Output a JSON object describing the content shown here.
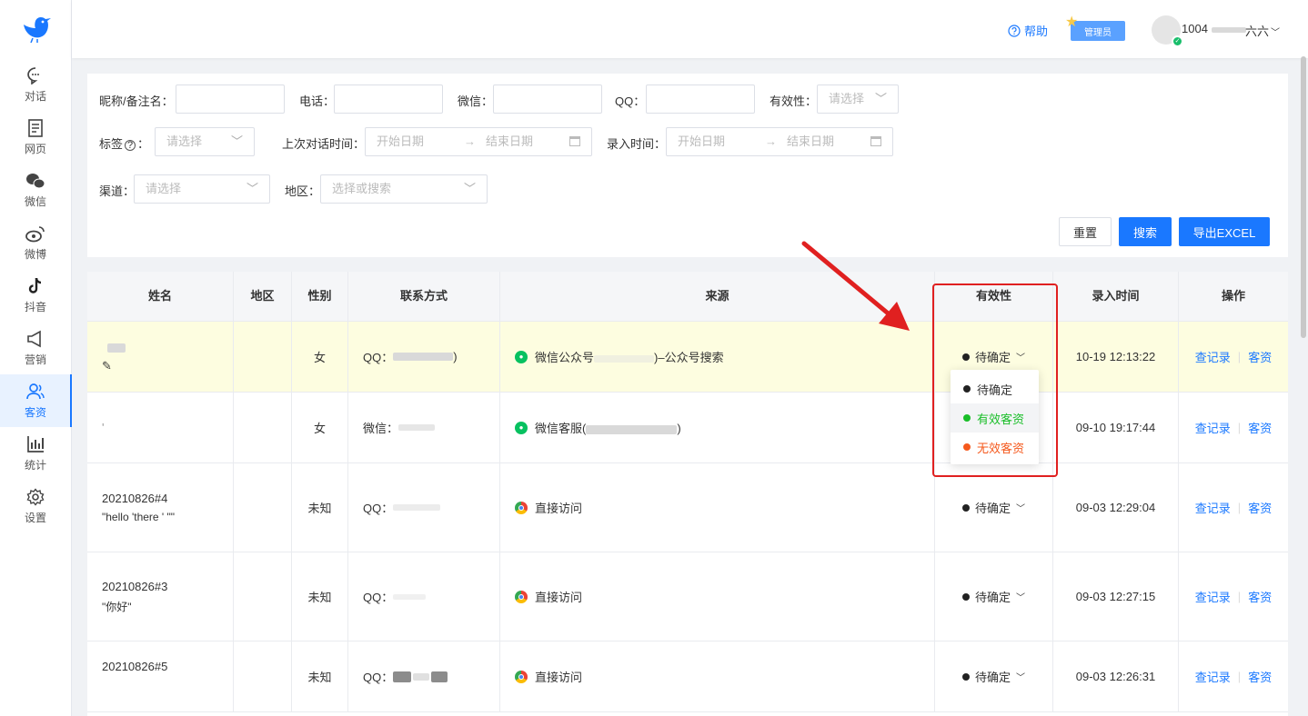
{
  "sidebar": {
    "items": [
      {
        "label": "对话",
        "icon": "chat-icon"
      },
      {
        "label": "网页",
        "icon": "webpage-icon"
      },
      {
        "label": "微信",
        "icon": "wechat-icon"
      },
      {
        "label": "微博",
        "icon": "weibo-icon"
      },
      {
        "label": "抖音",
        "icon": "douyin-icon"
      },
      {
        "label": "营销",
        "icon": "megaphone-icon"
      },
      {
        "label": "客资",
        "icon": "customers-icon"
      },
      {
        "label": "统计",
        "icon": "statistics-icon"
      },
      {
        "label": "设置",
        "icon": "gear-icon"
      }
    ],
    "active": "客资"
  },
  "header": {
    "help": "帮助",
    "admin_badge": "管理员",
    "user_id": "1004",
    "user_name": "六六"
  },
  "filters": {
    "nickname_label": "昵称/备注名：",
    "phone_label": "电话：",
    "wechat_label": "微信：",
    "qq_label": "QQ：",
    "validity_label": "有效性：",
    "validity_placeholder": "请选择",
    "tag_label": "标签",
    "tag_label_suffix": "：",
    "tag_placeholder": "请选择",
    "last_chat_label": "上次对话时间：",
    "entry_time_label": "录入时间：",
    "start_date": "开始日期",
    "end_date": "结束日期",
    "channel_label": "渠道：",
    "channel_placeholder": "请选择",
    "region_label": "地区：",
    "region_placeholder": "选择或搜索",
    "reset": "重置",
    "search": "搜索",
    "export": "导出EXCEL"
  },
  "table": {
    "columns": [
      "姓名",
      "地区",
      "性别",
      "联系方式",
      "来源",
      "有效性",
      "录入时间",
      "操作"
    ],
    "rows": [
      {
        "name": "",
        "name2": "",
        "gender": "女",
        "contact_prefix": "QQ：",
        "contact_suffix": ")",
        "source": "微信公众号",
        "source_suffix": ")–公众号搜索",
        "source_type": "wechat",
        "status": "待确定",
        "time": "10-19 12:13:22"
      },
      {
        "name": "'",
        "name2": "",
        "gender": "女",
        "contact_prefix": "微信：",
        "contact_suffix": "",
        "source": "微信客服(",
        "source_suffix": ")",
        "source_type": "wechat",
        "status": "",
        "time": "09-10 19:17:44"
      },
      {
        "name": "20210826#4",
        "name2": "\"hello 'there ' \"\"",
        "gender": "未知",
        "contact_prefix": "QQ：",
        "contact_suffix": "",
        "source": "直接访问",
        "source_suffix": "",
        "source_type": "chrome",
        "status": "待确定",
        "time": "09-03 12:29:04"
      },
      {
        "name": "20210826#3",
        "name2": "\"你好\"",
        "gender": "未知",
        "contact_prefix": "QQ：",
        "contact_suffix": "",
        "source": "直接访问",
        "source_suffix": "",
        "source_type": "chrome",
        "status": "待确定",
        "time": "09-03 12:27:15"
      },
      {
        "name": "20210826#5",
        "name2": "",
        "gender": "未知",
        "contact_prefix": "QQ：",
        "contact_suffix": "",
        "source": "直接访问",
        "source_suffix": "",
        "source_type": "chrome",
        "status": "待确定",
        "time": "09-03 12:26:31"
      }
    ],
    "actions": {
      "records": "查记录",
      "customer": "客资"
    }
  },
  "dropdown": {
    "options": [
      {
        "label": "待确定",
        "color": "#222222"
      },
      {
        "label": "有效客资",
        "color": "#19be28"
      },
      {
        "label": "无效客资",
        "color": "#f5591d"
      }
    ]
  },
  "colors": {
    "accent": "#1a78ff",
    "highlight_row": "#fdfde0",
    "annotation": "#e02020"
  }
}
